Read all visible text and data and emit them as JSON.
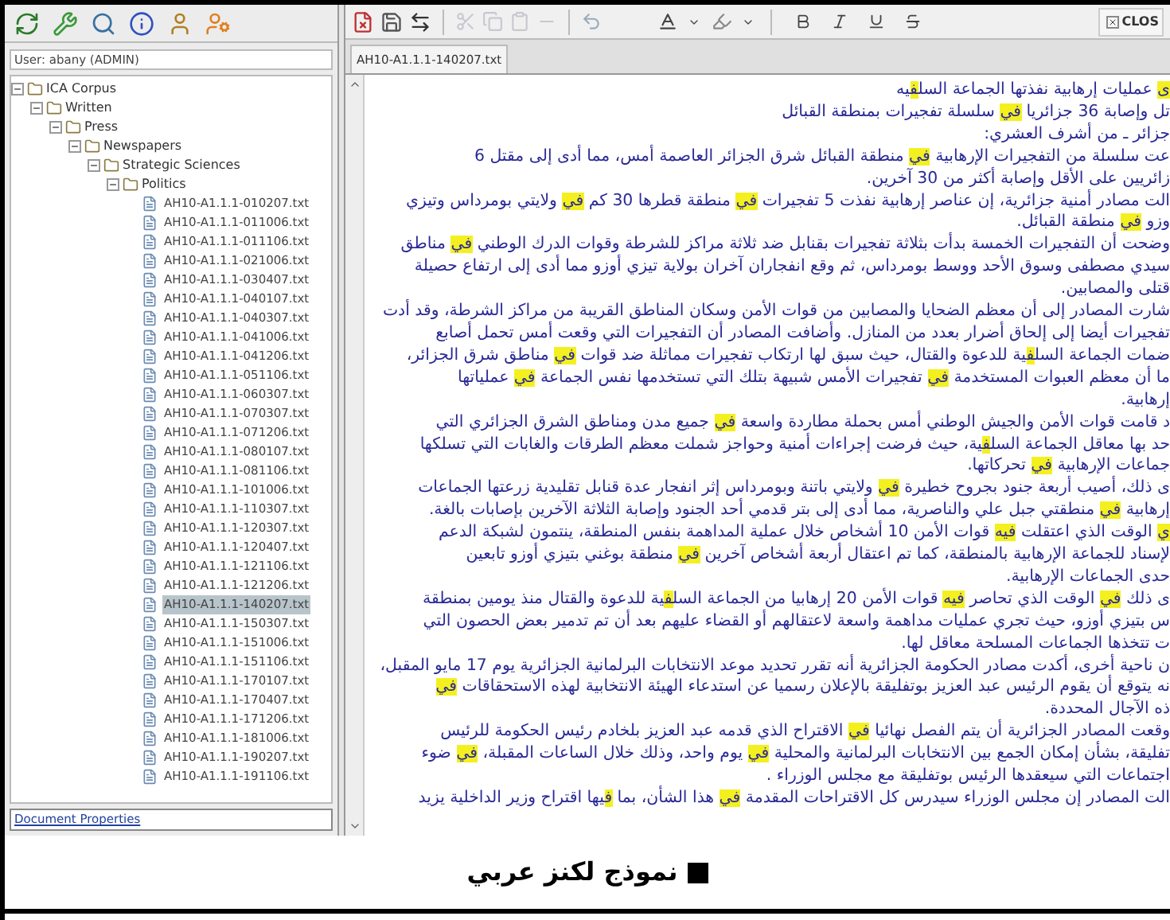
{
  "user_label": "User: abany (ADMIN)",
  "tree": [
    {
      "label": "ICA Corpus",
      "kind": "folder",
      "expanded": true,
      "children": [
        {
          "label": "Written",
          "kind": "folder",
          "expanded": true,
          "children": [
            {
              "label": "Press",
              "kind": "folder",
              "expanded": true,
              "children": [
                {
                  "label": "Newspapers",
                  "kind": "folder",
                  "expanded": true,
                  "children": [
                    {
                      "label": "Strategic Sciences",
                      "kind": "folder",
                      "expanded": true,
                      "children": [
                        {
                          "label": "Politics",
                          "kind": "folder",
                          "expanded": true,
                          "children": [
                            {
                              "label": "AH10-A1.1.1-010207.txt",
                              "kind": "file",
                              "selected": false
                            },
                            {
                              "label": "AH10-A1.1.1-011006.txt",
                              "kind": "file",
                              "selected": false
                            },
                            {
                              "label": "AH10-A1.1.1-011106.txt",
                              "kind": "file",
                              "selected": false
                            },
                            {
                              "label": "AH10-A1.1.1-021006.txt",
                              "kind": "file",
                              "selected": false
                            },
                            {
                              "label": "AH10-A1.1.1-030407.txt",
                              "kind": "file",
                              "selected": false
                            },
                            {
                              "label": "AH10-A1.1.1-040107.txt",
                              "kind": "file",
                              "selected": false
                            },
                            {
                              "label": "AH10-A1.1.1-040307.txt",
                              "kind": "file",
                              "selected": false
                            },
                            {
                              "label": "AH10-A1.1.1-041006.txt",
                              "kind": "file",
                              "selected": false
                            },
                            {
                              "label": "AH10-A1.1.1-041206.txt",
                              "kind": "file",
                              "selected": false
                            },
                            {
                              "label": "AH10-A1.1.1-051106.txt",
                              "kind": "file",
                              "selected": false
                            },
                            {
                              "label": "AH10-A1.1.1-060307.txt",
                              "kind": "file",
                              "selected": false
                            },
                            {
                              "label": "AH10-A1.1.1-070307.txt",
                              "kind": "file",
                              "selected": false
                            },
                            {
                              "label": "AH10-A1.1.1-071206.txt",
                              "kind": "file",
                              "selected": false
                            },
                            {
                              "label": "AH10-A1.1.1-080107.txt",
                              "kind": "file",
                              "selected": false
                            },
                            {
                              "label": "AH10-A1.1.1-081106.txt",
                              "kind": "file",
                              "selected": false
                            },
                            {
                              "label": "AH10-A1.1.1-101006.txt",
                              "kind": "file",
                              "selected": false
                            },
                            {
                              "label": "AH10-A1.1.1-110307.txt",
                              "kind": "file",
                              "selected": false
                            },
                            {
                              "label": "AH10-A1.1.1-120307.txt",
                              "kind": "file",
                              "selected": false
                            },
                            {
                              "label": "AH10-A1.1.1-120407.txt",
                              "kind": "file",
                              "selected": false
                            },
                            {
                              "label": "AH10-A1.1.1-121106.txt",
                              "kind": "file",
                              "selected": false
                            },
                            {
                              "label": "AH10-A1.1.1-121206.txt",
                              "kind": "file",
                              "selected": false
                            },
                            {
                              "label": "AH10-A1.1.1-140207.txt",
                              "kind": "file",
                              "selected": true
                            },
                            {
                              "label": "AH10-A1.1.1-150307.txt",
                              "kind": "file",
                              "selected": false
                            },
                            {
                              "label": "AH10-A1.1.1-151006.txt",
                              "kind": "file",
                              "selected": false
                            },
                            {
                              "label": "AH10-A1.1.1-151106.txt",
                              "kind": "file",
                              "selected": false
                            },
                            {
                              "label": "AH10-A1.1.1-170107.txt",
                              "kind": "file",
                              "selected": false
                            },
                            {
                              "label": "AH10-A1.1.1-170407.txt",
                              "kind": "file",
                              "selected": false
                            },
                            {
                              "label": "AH10-A1.1.1-171206.txt",
                              "kind": "file",
                              "selected": false
                            },
                            {
                              "label": "AH10-A1.1.1-181006.txt",
                              "kind": "file",
                              "selected": false
                            },
                            {
                              "label": "AH10-A1.1.1-190207.txt",
                              "kind": "file",
                              "selected": false
                            },
                            {
                              "label": "AH10-A1.1.1-191106.txt",
                              "kind": "file",
                              "selected": false
                            }
                          ]
                        }
                      ]
                    }
                  ]
                }
              ]
            }
          ]
        }
      ]
    }
  ],
  "document_properties": "Document Properties",
  "editor": {
    "close_button": "CLOS",
    "tab": "AH10-A1.1.1-140207.txt",
    "lines": [
      [
        {
          "text": "ى",
          "highlighted": true
        },
        {
          "text": " عمليات إرهابية نفذتها الجماعة السل",
          "highlighted": false
        },
        {
          "text": "ف",
          "highlighted": true
        },
        {
          "text": "يه",
          "highlighted": false
        }
      ],
      [
        {
          "text": "تل وإصابة 36 جزائريا ",
          "highlighted": false
        },
        {
          "text": "في",
          "highlighted": true
        },
        {
          "text": " سلسلة تفجيرات بمنطقة القبائل",
          "highlighted": false
        }
      ],
      [
        {
          "text": "جزائر ـ من أشرف العشري:",
          "highlighted": false
        }
      ],
      [
        {
          "text": "عت سلسلة من التفجيرات الإرهابية ",
          "highlighted": false
        },
        {
          "text": "في",
          "highlighted": true
        },
        {
          "text": " منطقة القبائل شرق الجزائر العاصمة أمس، مما أدى إلى مقتل 6",
          "highlighted": false
        }
      ],
      [
        {
          "text": "زائريين على الأقل وإصابة أكثر من 30 آخرين.",
          "highlighted": false
        }
      ],
      [
        {
          "text": "الت مصادر أمنية جزائرية، إن عناصر إرهابية نفذت 5 تفجيرات ",
          "highlighted": false
        },
        {
          "text": "في",
          "highlighted": true
        },
        {
          "text": " منطقة قطرها 30 كم ",
          "highlighted": false
        },
        {
          "text": "في",
          "highlighted": true
        },
        {
          "text": " ولايتي بومرداس وتيزي",
          "highlighted": false
        }
      ],
      [
        {
          "text": "وزو ",
          "highlighted": false
        },
        {
          "text": "في",
          "highlighted": true
        },
        {
          "text": " منطقة القبائل.",
          "highlighted": false
        }
      ],
      [
        {
          "text": "وضحت أن التفجيرات الخمسة بدأت بثلاثة تفجيرات بقنابل ضد ثلاثة مراكز للشرطة وقوات الدرك الوطني ",
          "highlighted": false
        },
        {
          "text": "في",
          "highlighted": true
        },
        {
          "text": " مناطق",
          "highlighted": false
        }
      ],
      [
        {
          "text": "سيدي مصطفى وسوق الأحد ووسط بومرداس، ثم وقع انفجاران آخران بولاية تيزي أوزو مما أدى إلى ارتفاع حصيلة",
          "highlighted": false
        }
      ],
      [
        {
          "text": "قتلى والمصابين.",
          "highlighted": false
        }
      ],
      [
        {
          "text": "شارت المصادر إلى أن معظم الضحايا والمصابين من قوات الأمن وسكان المناطق القريبة من مراكز الشرطة، وقد أدت",
          "highlighted": false
        }
      ],
      [
        {
          "text": "تفجيرات أيضا إلى إلحاق أضرار بعدد من المنازل. وأضافت المصادر أن التفجيرات التي وقعت أمس تحمل أصابع",
          "highlighted": false
        }
      ],
      [
        {
          "text": "ضمات الجماعة السل",
          "highlighted": false
        },
        {
          "text": "ف",
          "highlighted": true
        },
        {
          "text": "ية للدعوة والقتال، حيث سبق لها ارتكاب تفجيرات مماثلة ضد قوات ",
          "highlighted": false
        },
        {
          "text": "في",
          "highlighted": true
        },
        {
          "text": " مناطق شرق الجزائر،",
          "highlighted": false
        }
      ],
      [
        {
          "text": "ما أن معظم العبوات المستخدمة ",
          "highlighted": false
        },
        {
          "text": "في",
          "highlighted": true
        },
        {
          "text": " تفجيرات الأمس شبيهة بتلك التي تستخدمها نفس الجماعة ",
          "highlighted": false
        },
        {
          "text": "في",
          "highlighted": true
        },
        {
          "text": " عملياتها",
          "highlighted": false
        }
      ],
      [
        {
          "text": "إرهابية.",
          "highlighted": false
        }
      ],
      [
        {
          "text": "د قامت قوات الأمن والجيش الوطني أمس بحملة مطاردة واسعة ",
          "highlighted": false
        },
        {
          "text": "في",
          "highlighted": true
        },
        {
          "text": " جميع مدن ومناطق الشرق الجزائري التي",
          "highlighted": false
        }
      ],
      [
        {
          "text": "حد بها معاقل الجماعة السل",
          "highlighted": false
        },
        {
          "text": "ف",
          "highlighted": true
        },
        {
          "text": "ية، حيث فرضت إجراءات أمنية وحواجز شملت معظم الطرقات والغابات التي تسلكها",
          "highlighted": false
        }
      ],
      [
        {
          "text": "جماعات الإرهابية ",
          "highlighted": false
        },
        {
          "text": "في",
          "highlighted": true
        },
        {
          "text": " تحركاتها.",
          "highlighted": false
        }
      ],
      [
        {
          "text": "ى ذلك، أصيب أربعة جنود بجروح خطيرة ",
          "highlighted": false
        },
        {
          "text": "في",
          "highlighted": true
        },
        {
          "text": " ولايتي باتنة وبومرداس إثر انفجار عدة قنابل تقليدية زرعتها الجماعات",
          "highlighted": false
        }
      ],
      [
        {
          "text": "إرهابية ",
          "highlighted": false
        },
        {
          "text": "في",
          "highlighted": true
        },
        {
          "text": " منطقتي جبل علي والناصرية، مما أدى إلى بتر قدمي أحد الجنود وإصابة الثلاثة الآخرين بإصابات بالغة.",
          "highlighted": false
        }
      ],
      [
        {
          "text": "ي",
          "highlighted": true
        },
        {
          "text": " الوقت الذي اعتقلت ",
          "highlighted": false
        },
        {
          "text": "فيه",
          "highlighted": true
        },
        {
          "text": " قوات الأمن 10 أشخاص خلال عملية المداهمة بنفس المنطقة، ينتمون لشبكة الدعم",
          "highlighted": false
        }
      ],
      [
        {
          "text": "لإسناد للجماعة الإرهابية بالمنطقة، كما تم اعتقال أربعة أشخاص آخرين ",
          "highlighted": false
        },
        {
          "text": "في",
          "highlighted": true
        },
        {
          "text": " منطقة بوغني بتيزي أوزو تابعين",
          "highlighted": false
        }
      ],
      [
        {
          "text": "حدى الجماعات الإرهابية.",
          "highlighted": false
        }
      ],
      [
        {
          "text": "ى ذلك ",
          "highlighted": false
        },
        {
          "text": "في",
          "highlighted": true
        },
        {
          "text": " الوقت الذي تحاصر ",
          "highlighted": false
        },
        {
          "text": "فيه",
          "highlighted": true
        },
        {
          "text": " قوات الأمن 20 إرهابيا من الجماعة السل",
          "highlighted": false
        },
        {
          "text": "ف",
          "highlighted": true
        },
        {
          "text": "ية للدعوة والقتال منذ يومين بمنطقة",
          "highlighted": false
        }
      ],
      [
        {
          "text": "س بتيزي أوزو، حيث تجري عمليات مداهمة واسعة لاعتقالهم أو القضاء عليهم بعد أن تم تدمير بعض الحصون التي",
          "highlighted": false
        }
      ],
      [
        {
          "text": "ت تتخذها الجماعات المسلحة معاقل لها.",
          "highlighted": false
        }
      ],
      [
        {
          "text": "ن ناحية أخرى، أكدت مصادر الحكومة الجزائرية أنه تقرر تحديد موعد الانتخابات البرلمانية الجزائرية يوم 17 مايو المقبل،",
          "highlighted": false
        }
      ],
      [
        {
          "text": "نه يتوقع أن يقوم الرئيس عبد العزيز بوتفليقة بالإعلان رسميا عن استدعاء الهيئة الانتخابية لهذه الاستحقاقات ",
          "highlighted": false
        },
        {
          "text": "في",
          "highlighted": true
        }
      ],
      [
        {
          "text": "ذه الآجال المحددة.",
          "highlighted": false
        }
      ],
      [
        {
          "text": "وقعت المصادر الجزائرية أن يتم الفصل نهائيا ",
          "highlighted": false
        },
        {
          "text": "في",
          "highlighted": true
        },
        {
          "text": " الاقتراح الذي قدمه عبد العزيز بلخادم رئيس الحكومة للرئيس",
          "highlighted": false
        }
      ],
      [
        {
          "text": "تفليقة، بشأن إمكان الجمع بين الانتخابات البرلمانية والمحلية ",
          "highlighted": false
        },
        {
          "text": "في",
          "highlighted": true
        },
        {
          "text": " يوم واحد، وذلك خلال الساعات المقبلة، ",
          "highlighted": false
        },
        {
          "text": "في",
          "highlighted": true
        },
        {
          "text": " ضوء",
          "highlighted": false
        }
      ],
      [
        {
          "text": "اجتماعات التي سيعقدها الرئيس بوتفليقة مع مجلس الوزراء .",
          "highlighted": false
        }
      ],
      [
        {
          "text": "الت المصادر إن مجلس الوزراء سيدرس كل الاقتراحات المقدمة ",
          "highlighted": false
        },
        {
          "text": "في",
          "highlighted": true
        },
        {
          "text": " هذا الشأن، بما ",
          "highlighted": false
        },
        {
          "text": "ف",
          "highlighted": true
        },
        {
          "text": "يها اقتراح وزير الداخلية يزيد",
          "highlighted": false
        }
      ]
    ]
  },
  "caption": "نموذج لكنز عربي"
}
